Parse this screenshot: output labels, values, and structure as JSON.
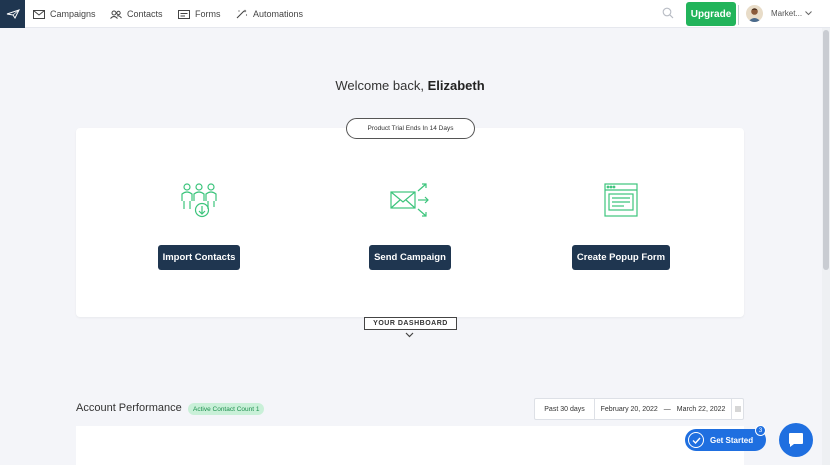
{
  "nav": {
    "items": [
      {
        "label": "Campaigns",
        "icon": "envelope-icon"
      },
      {
        "label": "Contacts",
        "icon": "people-icon"
      },
      {
        "label": "Forms",
        "icon": "form-icon"
      },
      {
        "label": "Automations",
        "icon": "magic-wand-icon"
      }
    ],
    "upgrade_label": "Upgrade",
    "account_label": "Market..."
  },
  "welcome": {
    "prefix": "Welcome back, ",
    "name": "Elizabeth"
  },
  "trial": {
    "label": "Product Trial Ends In 14 Days"
  },
  "actions": [
    {
      "label": "Import Contacts",
      "icon": "import-contacts-icon"
    },
    {
      "label": "Send Campaign",
      "icon": "send-campaign-icon"
    },
    {
      "label": "Create Popup Form",
      "icon": "popup-form-icon"
    }
  ],
  "dashboard": {
    "tab_label": "YOUR DASHBOARD"
  },
  "performance": {
    "title": "Account Performance",
    "badge": "Active Contact Count 1",
    "period": "Past 30 days",
    "date_start": "February 20, 2022",
    "date_sep": "—",
    "date_end": "March 22, 2022"
  },
  "get_started": {
    "label": "Get Started",
    "count": "3"
  },
  "colors": {
    "navy": "#1f3650",
    "green": "#22b45b",
    "blue": "#1f6fe0",
    "icon_green": "#3cc47c"
  }
}
